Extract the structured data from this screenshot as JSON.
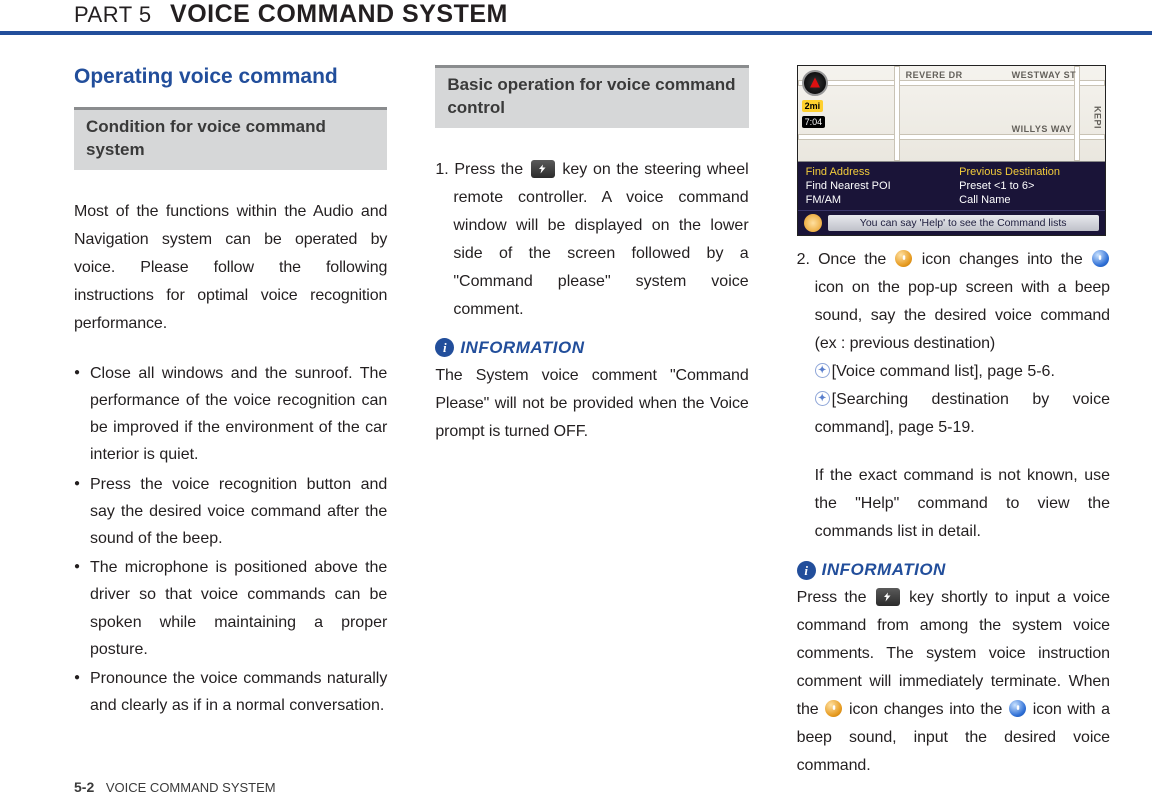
{
  "header": {
    "part": "PART 5",
    "title": "VOICE COMMAND SYSTEM"
  },
  "col1": {
    "section_title": "Operating voice command",
    "sub_title": "Condition for voice command system",
    "intro": "Most of the functions within the Audio and Navigation system can be operated by voice. Please follow the following instructions for optimal voice recognition performance.",
    "bullets": [
      "Close all windows and the sunroof. The performance of the voice recognition can be improved if the environment of the car interior is quiet.",
      "Press the voice recognition button and say the desired voice command after the sound of the beep.",
      "The microphone is positioned above the driver so that voice commands can be spoken while maintaining a proper posture.",
      "Pronounce the voice commands naturally and clearly as if in a normal conversation."
    ]
  },
  "col2": {
    "sub_title": "Basic operation for voice command control",
    "step1_a": "1. Press the ",
    "step1_b": " key on the steering wheel remote controller. A voice command window will be displayed on the lower side of the screen followed by a \"Command please\" system voice comment.",
    "info_label": "INFORMATION",
    "info_text": "The System voice comment \"Command Please\" will not be provided when the Voice prompt is turned OFF."
  },
  "col3": {
    "step2_a": "2. Once the ",
    "step2_b": " icon changes into the ",
    "step2_c": " icon on the pop-up screen with a beep sound, say the desired voice command (ex : previous destination)",
    "ref1": "[Voice command list], page 5-6.",
    "ref2": "[Searching destination by voice command], page 5-19.",
    "help_text": "If the exact command is not known, use the \"Help\" command to view the commands list in detail.",
    "info_label": "INFORMATION",
    "info2_a": "Press the ",
    "info2_b": " key shortly to input a voice command from among the system voice comments. The system voice instruction comment will immediately terminate. When the ",
    "info2_c": " icon changes into the ",
    "info2_d": " icon with a beep sound, input the desired voice command."
  },
  "nav": {
    "road1": "REVERE DR",
    "road2": "WESTWAY ST",
    "road3": "WILLYS WAY",
    "side": "KEPI",
    "dist": "2mi",
    "time": "7:04",
    "menu_left": [
      "Find Address",
      "Find Nearest POI",
      "FM/AM"
    ],
    "menu_right": [
      "Previous Destination",
      "Preset <1 to 6>",
      "Call Name"
    ],
    "say": "You can say 'Help' to see the Command lists"
  },
  "footer": {
    "page": "5-2",
    "label": "VOICE COMMAND SYSTEM"
  }
}
